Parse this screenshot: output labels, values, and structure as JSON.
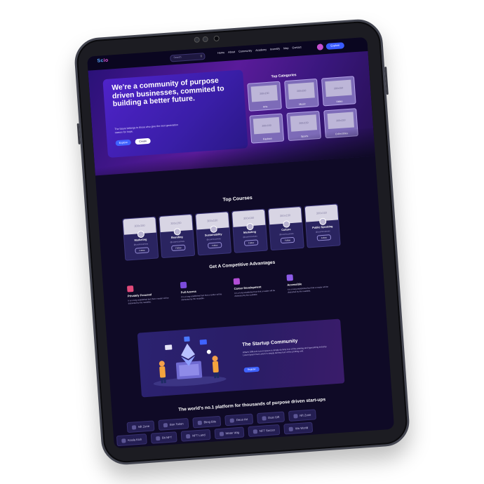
{
  "nav": {
    "logo_primary": "Sc",
    "logo_accent": "io",
    "search_placeholder": "Search",
    "menu": [
      "Home",
      "About",
      "Community",
      "Academy",
      "Inventify",
      "Map",
      "Contact"
    ],
    "explore_label": "Explore"
  },
  "hero": {
    "title": "We're a community of purpose driven businesses, commited to building a better future.",
    "subtitle": "The future belongs to those who give the next generation reason for hope.",
    "explore_label": "Explore",
    "create_label": "Create"
  },
  "categories": {
    "title": "Top Categories",
    "items": [
      {
        "label": "Arts",
        "placeholder": "300x150"
      },
      {
        "label": "Music",
        "placeholder": "300x150"
      },
      {
        "label": "Video",
        "placeholder": "300x150"
      },
      {
        "label": "Fashion",
        "placeholder": "300x150"
      },
      {
        "label": "Sports",
        "placeholder": "300x150"
      },
      {
        "label": "Collectibles",
        "placeholder": "300x150"
      }
    ]
  },
  "courses": {
    "title": "Top Courses",
    "items": [
      {
        "name": "Marketing",
        "handle": "@cosmiccanvas",
        "placeholder": "300x150",
        "follow": "Follow"
      },
      {
        "name": "Branding",
        "handle": "@cosmiccanvas",
        "placeholder": "300x150",
        "follow": "Follow"
      },
      {
        "name": "Sustainability",
        "handle": "@cosmiccanvas",
        "placeholder": "300x150",
        "follow": "Follow"
      },
      {
        "name": "Marketing",
        "handle": "@cosmiccanvas",
        "placeholder": "300x150",
        "follow": "Follow"
      },
      {
        "name": "Culture",
        "handle": "@cosmiccanvas",
        "placeholder": "300x150",
        "follow": "Follow"
      },
      {
        "name": "Public Speaking",
        "handle": "@cosmiccanvas",
        "placeholder": "300x150",
        "follow": "Follow"
      }
    ]
  },
  "advantages": {
    "title": "Get A Competitive Advantages",
    "items": [
      {
        "title": "Privately Focused",
        "desc": "It is a long established fact that a reader will be distracted by the readable.",
        "color": "#e24a7a"
      },
      {
        "title": "Full Access",
        "desc": "It is a long established fact that a reader will be distracted by the readable.",
        "color": "#7b4bdc"
      },
      {
        "title": "Career Development",
        "desc": "It is a long established fact that a reader will be distracted by the readable.",
        "color": "#b24ed6"
      },
      {
        "title": "Accessible",
        "desc": "It is a long established fact that a reader will be distracted by the readable.",
        "color": "#8d5be8"
      }
    ]
  },
  "startup": {
    "title": "The Startup Community",
    "desc": "What's Different Lorem Ipsum is simply dummy text of the printing and typesetting industry. Lorem Ipsum has Lorem is simply dummy text of the printing and.",
    "button": "Register"
  },
  "partners": {
    "title": "The world's no.1 platform for thousands of purpose driven start-ups",
    "row1": [
      "Nft Zone",
      "Bon Token",
      "Bling Bits",
      "Deuo Art",
      "Dust Gift",
      "Nft Zone"
    ],
    "row2": [
      "Koala Kick",
      "Bit NFT",
      "NFT Land",
      "Water Wig",
      "NFT Soccer",
      "Wo World"
    ]
  }
}
